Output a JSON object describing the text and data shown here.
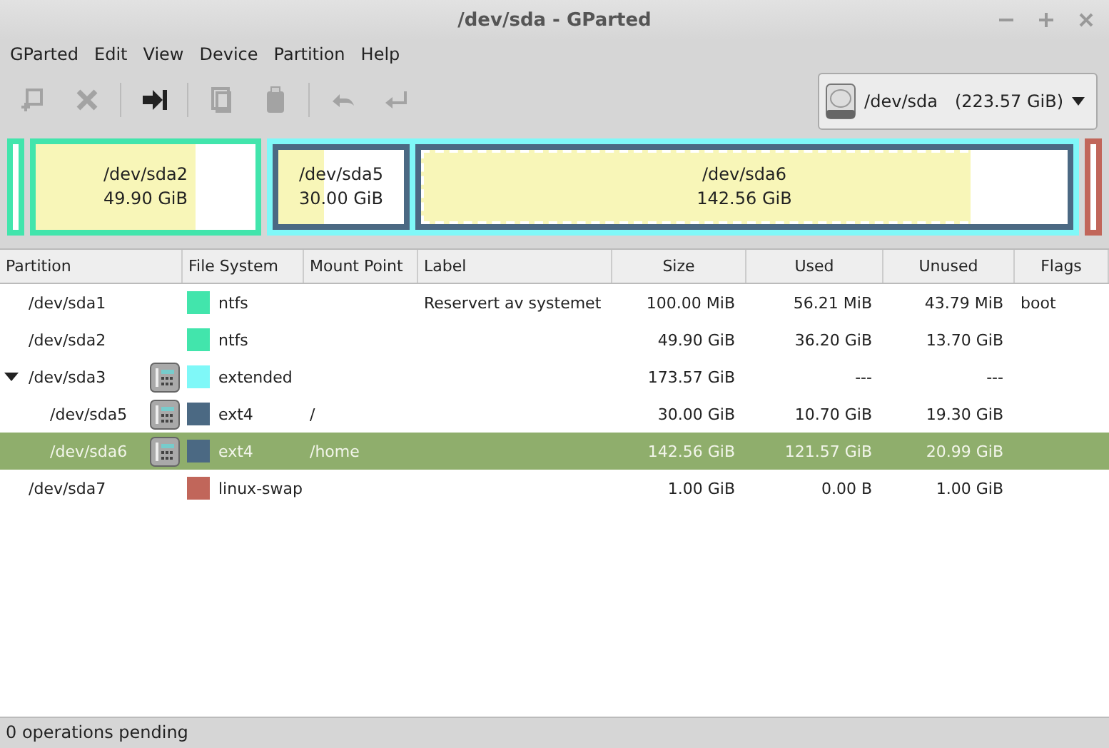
{
  "window": {
    "title": "/dev/sda - GParted"
  },
  "menu": [
    "GParted",
    "Edit",
    "View",
    "Device",
    "Partition",
    "Help"
  ],
  "toolbar": [
    {
      "kind": "new",
      "disabled": true
    },
    {
      "kind": "delete",
      "disabled": true
    },
    {
      "kind": "sep"
    },
    {
      "kind": "resize",
      "disabled": false
    },
    {
      "kind": "sep"
    },
    {
      "kind": "copy",
      "disabled": true
    },
    {
      "kind": "paste",
      "disabled": true
    },
    {
      "kind": "sep"
    },
    {
      "kind": "undo",
      "disabled": true
    },
    {
      "kind": "apply",
      "disabled": true
    }
  ],
  "device": {
    "name": "/dev/sda",
    "size": "(223.57 GiB)"
  },
  "disk_map": [
    {
      "kind": "sliver",
      "color": "#42e5ac"
    },
    {
      "kind": "partition",
      "color": "#42e5ac",
      "name": "/dev/sda2",
      "size": "49.90 GiB",
      "level": 0.73,
      "selected": false
    },
    {
      "kind": "extended",
      "color": "#7ff8f8",
      "children": [
        {
          "kind": "partition",
          "color": "#4b6983",
          "name": "/dev/sda5",
          "size": "30.00 GiB",
          "level": 0.36,
          "selected": false
        },
        {
          "kind": "partition",
          "color": "#4b6983",
          "name": "/dev/sda6",
          "size": "142.56 GiB",
          "level": 0.85,
          "selected": true
        }
      ]
    },
    {
      "kind": "sliver",
      "color": "#c1665a"
    }
  ],
  "table": {
    "columns": [
      "Partition",
      "File System",
      "Mount Point",
      "Label",
      "Size",
      "Used",
      "Unused",
      "Flags"
    ],
    "rows": [
      {
        "partition": "/dev/sda1",
        "busy": false,
        "color": "#42e5ac",
        "file_system": "ntfs",
        "label": "Reservert av systemet",
        "size": "100.00 MiB",
        "used": "56.21 MiB",
        "unused": "43.79 MiB",
        "flags": "boot",
        "selected": false
      },
      {
        "partition": "/dev/sda2",
        "busy": false,
        "color": "#42e5ac",
        "file_system": "ntfs",
        "size": "49.90 GiB",
        "used": "36.20 GiB",
        "unused": "13.70 GiB",
        "selected": false
      },
      {
        "partition": "/dev/sda3",
        "busy": true,
        "color": "#7ff8f8",
        "file_system": "extended",
        "size": "173.57 GiB",
        "used": "---",
        "unused": "---",
        "selected": false,
        "expanded": true,
        "children": [
          {
            "partition": "/dev/sda5",
            "busy": true,
            "color": "#4b6983",
            "file_system": "ext4",
            "mount_point": "/",
            "size": "30.00 GiB",
            "used": "10.70 GiB",
            "unused": "19.30 GiB",
            "selected": false
          },
          {
            "partition": "/dev/sda6",
            "busy": true,
            "color": "#4b6983",
            "file_system": "ext4",
            "mount_point": "/home",
            "size": "142.56 GiB",
            "used": "121.57 GiB",
            "unused": "20.99 GiB",
            "selected": true
          }
        ]
      },
      {
        "partition": "/dev/sda7",
        "busy": false,
        "color": "#c1665a",
        "file_system": "linux-swap",
        "size": "1.00 GiB",
        "used": "0.00 B",
        "unused": "1.00 GiB",
        "selected": false
      }
    ]
  },
  "status_bar": "0 operations pending"
}
